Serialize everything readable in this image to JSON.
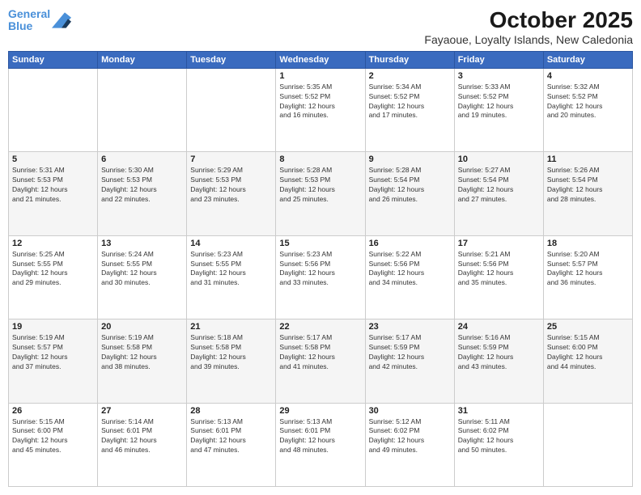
{
  "logo": {
    "line1": "General",
    "line2": "Blue"
  },
  "title": "October 2025",
  "subtitle": "Fayaoue, Loyalty Islands, New Caledonia",
  "days_header": [
    "Sunday",
    "Monday",
    "Tuesday",
    "Wednesday",
    "Thursday",
    "Friday",
    "Saturday"
  ],
  "weeks": [
    [
      {
        "day": "",
        "info": ""
      },
      {
        "day": "",
        "info": ""
      },
      {
        "day": "",
        "info": ""
      },
      {
        "day": "1",
        "info": "Sunrise: 5:35 AM\nSunset: 5:52 PM\nDaylight: 12 hours\nand 16 minutes."
      },
      {
        "day": "2",
        "info": "Sunrise: 5:34 AM\nSunset: 5:52 PM\nDaylight: 12 hours\nand 17 minutes."
      },
      {
        "day": "3",
        "info": "Sunrise: 5:33 AM\nSunset: 5:52 PM\nDaylight: 12 hours\nand 19 minutes."
      },
      {
        "day": "4",
        "info": "Sunrise: 5:32 AM\nSunset: 5:52 PM\nDaylight: 12 hours\nand 20 minutes."
      }
    ],
    [
      {
        "day": "5",
        "info": "Sunrise: 5:31 AM\nSunset: 5:53 PM\nDaylight: 12 hours\nand 21 minutes."
      },
      {
        "day": "6",
        "info": "Sunrise: 5:30 AM\nSunset: 5:53 PM\nDaylight: 12 hours\nand 22 minutes."
      },
      {
        "day": "7",
        "info": "Sunrise: 5:29 AM\nSunset: 5:53 PM\nDaylight: 12 hours\nand 23 minutes."
      },
      {
        "day": "8",
        "info": "Sunrise: 5:28 AM\nSunset: 5:53 PM\nDaylight: 12 hours\nand 25 minutes."
      },
      {
        "day": "9",
        "info": "Sunrise: 5:28 AM\nSunset: 5:54 PM\nDaylight: 12 hours\nand 26 minutes."
      },
      {
        "day": "10",
        "info": "Sunrise: 5:27 AM\nSunset: 5:54 PM\nDaylight: 12 hours\nand 27 minutes."
      },
      {
        "day": "11",
        "info": "Sunrise: 5:26 AM\nSunset: 5:54 PM\nDaylight: 12 hours\nand 28 minutes."
      }
    ],
    [
      {
        "day": "12",
        "info": "Sunrise: 5:25 AM\nSunset: 5:55 PM\nDaylight: 12 hours\nand 29 minutes."
      },
      {
        "day": "13",
        "info": "Sunrise: 5:24 AM\nSunset: 5:55 PM\nDaylight: 12 hours\nand 30 minutes."
      },
      {
        "day": "14",
        "info": "Sunrise: 5:23 AM\nSunset: 5:55 PM\nDaylight: 12 hours\nand 31 minutes."
      },
      {
        "day": "15",
        "info": "Sunrise: 5:23 AM\nSunset: 5:56 PM\nDaylight: 12 hours\nand 33 minutes."
      },
      {
        "day": "16",
        "info": "Sunrise: 5:22 AM\nSunset: 5:56 PM\nDaylight: 12 hours\nand 34 minutes."
      },
      {
        "day": "17",
        "info": "Sunrise: 5:21 AM\nSunset: 5:56 PM\nDaylight: 12 hours\nand 35 minutes."
      },
      {
        "day": "18",
        "info": "Sunrise: 5:20 AM\nSunset: 5:57 PM\nDaylight: 12 hours\nand 36 minutes."
      }
    ],
    [
      {
        "day": "19",
        "info": "Sunrise: 5:19 AM\nSunset: 5:57 PM\nDaylight: 12 hours\nand 37 minutes."
      },
      {
        "day": "20",
        "info": "Sunrise: 5:19 AM\nSunset: 5:58 PM\nDaylight: 12 hours\nand 38 minutes."
      },
      {
        "day": "21",
        "info": "Sunrise: 5:18 AM\nSunset: 5:58 PM\nDaylight: 12 hours\nand 39 minutes."
      },
      {
        "day": "22",
        "info": "Sunrise: 5:17 AM\nSunset: 5:58 PM\nDaylight: 12 hours\nand 41 minutes."
      },
      {
        "day": "23",
        "info": "Sunrise: 5:17 AM\nSunset: 5:59 PM\nDaylight: 12 hours\nand 42 minutes."
      },
      {
        "day": "24",
        "info": "Sunrise: 5:16 AM\nSunset: 5:59 PM\nDaylight: 12 hours\nand 43 minutes."
      },
      {
        "day": "25",
        "info": "Sunrise: 5:15 AM\nSunset: 6:00 PM\nDaylight: 12 hours\nand 44 minutes."
      }
    ],
    [
      {
        "day": "26",
        "info": "Sunrise: 5:15 AM\nSunset: 6:00 PM\nDaylight: 12 hours\nand 45 minutes."
      },
      {
        "day": "27",
        "info": "Sunrise: 5:14 AM\nSunset: 6:01 PM\nDaylight: 12 hours\nand 46 minutes."
      },
      {
        "day": "28",
        "info": "Sunrise: 5:13 AM\nSunset: 6:01 PM\nDaylight: 12 hours\nand 47 minutes."
      },
      {
        "day": "29",
        "info": "Sunrise: 5:13 AM\nSunset: 6:01 PM\nDaylight: 12 hours\nand 48 minutes."
      },
      {
        "day": "30",
        "info": "Sunrise: 5:12 AM\nSunset: 6:02 PM\nDaylight: 12 hours\nand 49 minutes."
      },
      {
        "day": "31",
        "info": "Sunrise: 5:11 AM\nSunset: 6:02 PM\nDaylight: 12 hours\nand 50 minutes."
      },
      {
        "day": "",
        "info": ""
      }
    ]
  ]
}
